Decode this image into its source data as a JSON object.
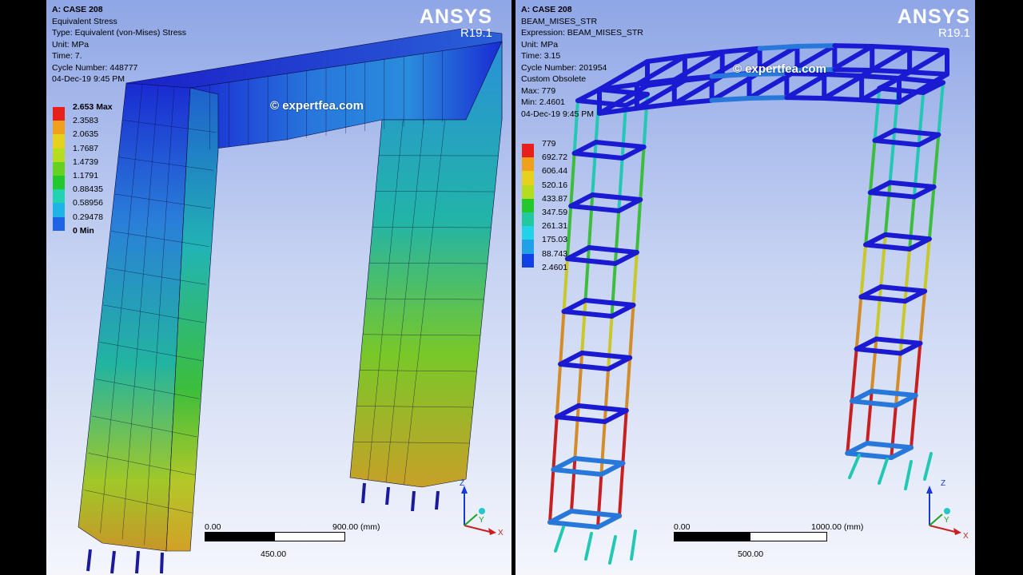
{
  "left": {
    "info": [
      {
        "text": "A: CASE 208",
        "bold": true
      },
      {
        "text": "Equivalent Stress",
        "bold": false
      },
      {
        "text": "Type: Equivalent (von-Mises) Stress",
        "bold": false
      },
      {
        "text": "Unit: MPa",
        "bold": false
      },
      {
        "text": "Time: 7.",
        "bold": false
      },
      {
        "text": "Cycle Number: 448777",
        "bold": false
      },
      {
        "text": "04-Dec-19 9:45 PM",
        "bold": false
      }
    ],
    "brand": "ANSYS",
    "version": "R19.1",
    "watermark": "© expertfea.com",
    "legend": [
      {
        "label": "2.653 Max",
        "bold": true
      },
      {
        "label": "2.3583",
        "bold": false
      },
      {
        "label": "2.0635",
        "bold": false
      },
      {
        "label": "1.7687",
        "bold": false
      },
      {
        "label": "1.4739",
        "bold": false
      },
      {
        "label": "1.1791",
        "bold": false
      },
      {
        "label": "0.88435",
        "bold": false
      },
      {
        "label": "0.58956",
        "bold": false
      },
      {
        "label": "0.29478",
        "bold": false
      }
    ],
    "legend_end": "0 Min",
    "legend_colors": [
      "#e8201b",
      "#f0a01a",
      "#e6d21c",
      "#b5dc1e",
      "#64d21e",
      "#22c82c",
      "#22d2b0",
      "#20b4e6",
      "#2064e6"
    ],
    "scale": {
      "start": "0.00",
      "end": "900.00 (mm)",
      "mid": "450.00"
    }
  },
  "right": {
    "info": [
      {
        "text": "A: CASE 208",
        "bold": true
      },
      {
        "text": "BEAM_MISES_STR",
        "bold": false
      },
      {
        "text": "Expression: BEAM_MISES_STR",
        "bold": false
      },
      {
        "text": "Unit: MPa",
        "bold": false
      },
      {
        "text": "Time: 3.15",
        "bold": false
      },
      {
        "text": "Cycle Number: 201954",
        "bold": false
      },
      {
        "text": "Custom Obsolete",
        "bold": false
      },
      {
        "text": "Max: 779",
        "bold": false
      },
      {
        "text": "Min: 2.4601",
        "bold": false
      },
      {
        "text": "04-Dec-19 9:45 PM",
        "bold": false
      }
    ],
    "brand": "ANSYS",
    "version": "R19.1",
    "watermark": "© expertfea.com",
    "legend": [
      {
        "label": "779",
        "bold": false
      },
      {
        "label": "692.72",
        "bold": false
      },
      {
        "label": "606.44",
        "bold": false
      },
      {
        "label": "520.16",
        "bold": false
      },
      {
        "label": "433.87",
        "bold": false
      },
      {
        "label": "347.59",
        "bold": false
      },
      {
        "label": "261.31",
        "bold": false
      },
      {
        "label": "175.03",
        "bold": false
      },
      {
        "label": "88.743",
        "bold": false
      },
      {
        "label": "2.4601",
        "bold": false
      }
    ],
    "legend_colors": [
      "#e8201b",
      "#f0a01a",
      "#e6d21c",
      "#b5dc1e",
      "#22c82c",
      "#22c8a0",
      "#22d2e6",
      "#20a0e6",
      "#1040e6"
    ],
    "scale": {
      "start": "0.00",
      "end": "1000.00 (mm)",
      "mid": "500.00"
    }
  },
  "triad": {
    "z": "Z",
    "y": "Y",
    "x": "X"
  },
  "colors": {
    "deep_blue": "#1a1ad2",
    "mid_blue": "#2878dc",
    "cyan": "#22c8b4",
    "green": "#3cbe3c",
    "yellow": "#c8c828",
    "orange": "#d28c28",
    "red": "#c82020"
  }
}
